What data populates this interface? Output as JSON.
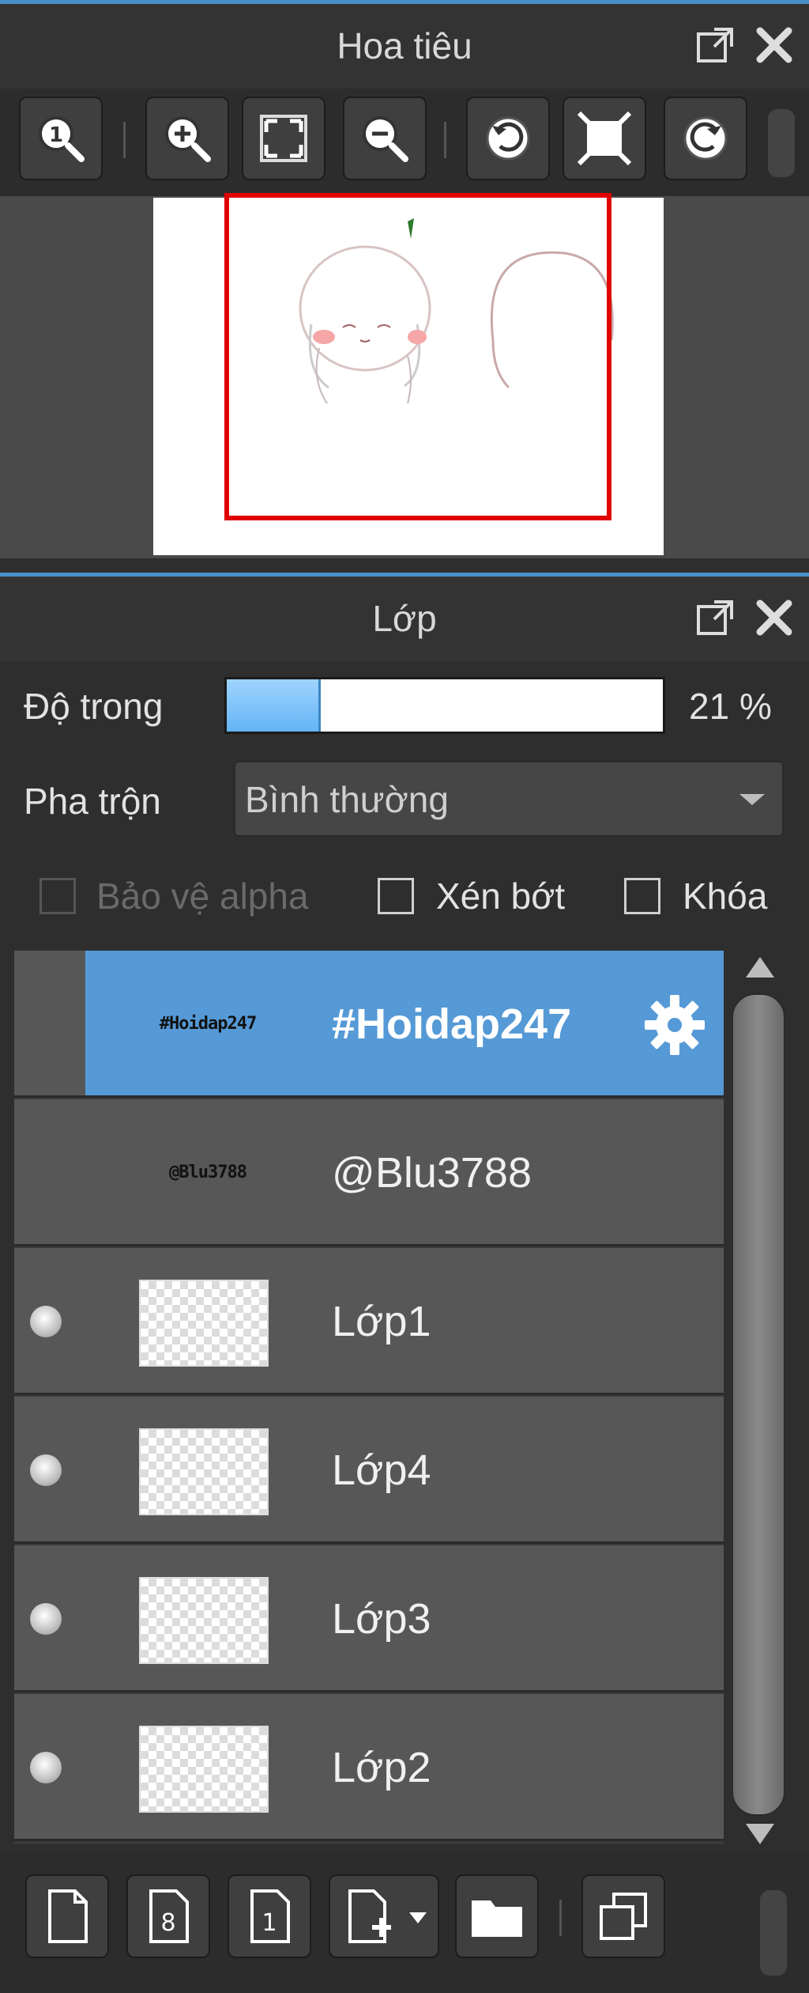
{
  "navigator": {
    "title": "Hoa tiêu"
  },
  "layers_panel": {
    "title": "Lớp",
    "opacity_label": "Độ trong",
    "opacity_percent": 21,
    "opacity_text": "21 %",
    "blend_label": "Pha trộn",
    "blend_value": "Bình thường",
    "checkbox_alpha": "Bảo vệ alpha",
    "checkbox_clip": "Xén bớt",
    "checkbox_lock": "Khóa",
    "layers": [
      {
        "name": "#Hoidap247",
        "thumb_text": "#Hoidap247",
        "selected": true
      },
      {
        "name": "@Blu3788",
        "thumb_text": "@Blu3788",
        "selected": false
      },
      {
        "name": "Lớp1",
        "selected": false
      },
      {
        "name": "Lớp4",
        "selected": false
      },
      {
        "name": "Lớp3",
        "selected": false
      },
      {
        "name": "Lớp2",
        "selected": false
      }
    ]
  },
  "colors": {
    "accent": "#4a90c8",
    "selected_row": "#5599d6",
    "viewbox": "#e00000"
  }
}
